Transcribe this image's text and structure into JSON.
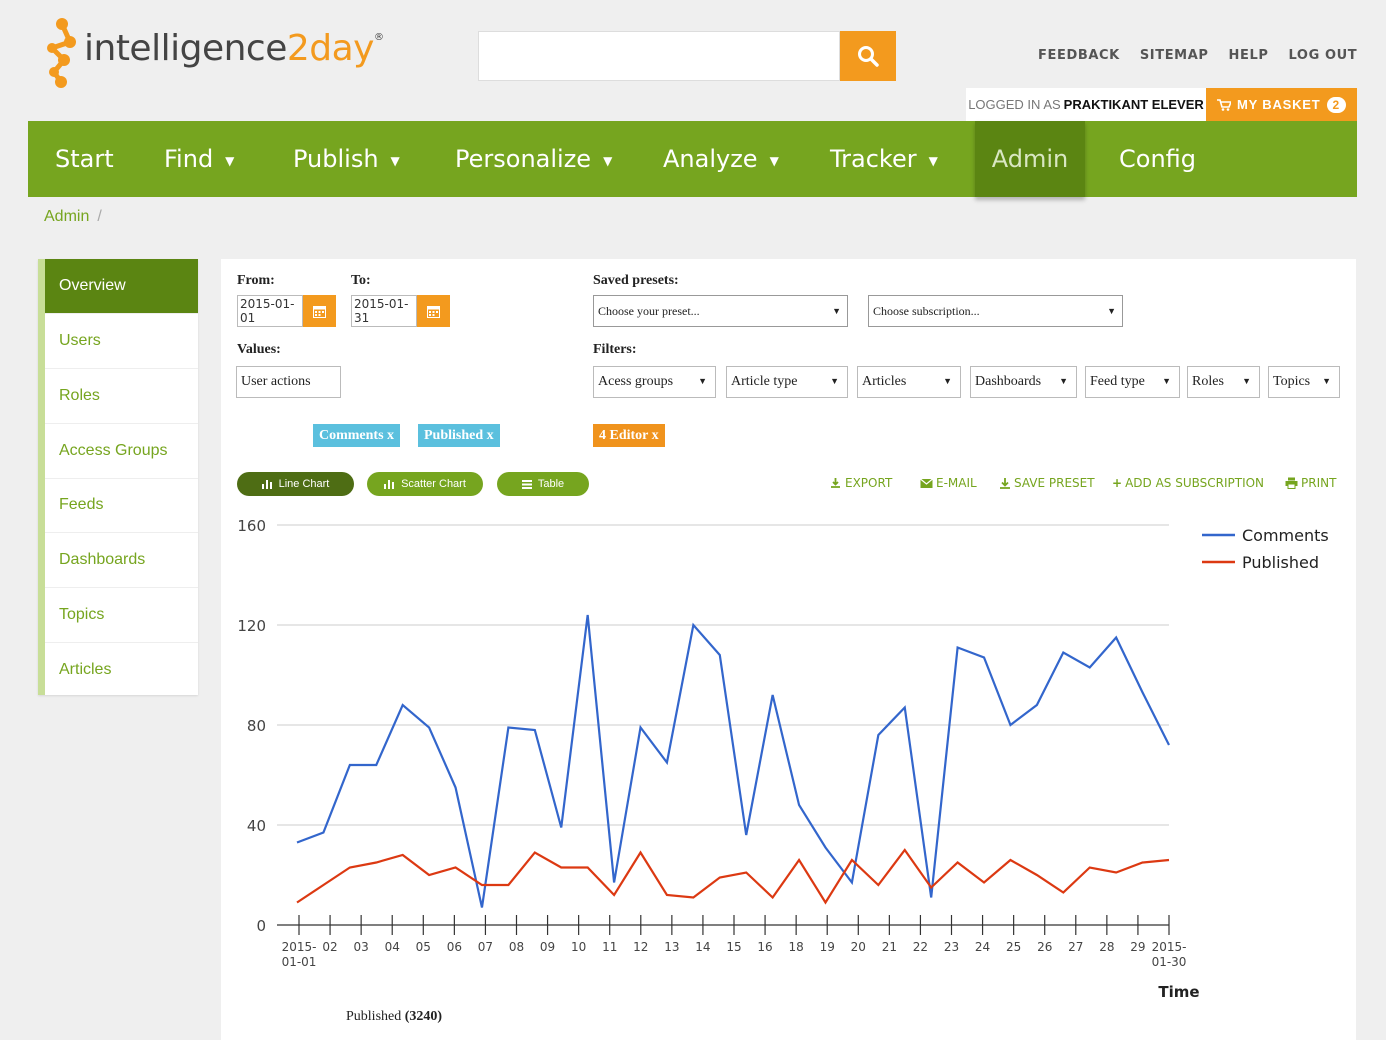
{
  "header": {
    "logo_text_main": "intelligence",
    "logo_text_accent": "2day",
    "logo_reg": "®",
    "search": {
      "placeholder": "",
      "value": ""
    },
    "top_links": [
      "FEEDBACK",
      "SITEMAP",
      "HELP",
      "LOG OUT"
    ],
    "logged_in_prefix": "LOGGED IN AS",
    "logged_in_user": "PRAKTIKANT ELEVER",
    "basket_label": "MY BASKET",
    "basket_count": "2"
  },
  "nav": {
    "items": [
      {
        "label": "Start"
      },
      {
        "label": "Find"
      },
      {
        "label": "Publish"
      },
      {
        "label": "Personalize"
      },
      {
        "label": "Analyze"
      },
      {
        "label": "Tracker"
      },
      {
        "label": "Admin"
      },
      {
        "label": "Config"
      }
    ],
    "active": "Admin"
  },
  "breadcrumb": {
    "current": "Admin",
    "separator": "/"
  },
  "sidebar": {
    "items": [
      {
        "label": "Overview"
      },
      {
        "label": "Users"
      },
      {
        "label": "Roles"
      },
      {
        "label": "Access Groups"
      },
      {
        "label": "Feeds"
      },
      {
        "label": "Dashboards"
      },
      {
        "label": "Topics"
      },
      {
        "label": "Articles"
      }
    ],
    "active": "Overview"
  },
  "form": {
    "from_label": "From:",
    "from_value": "2015-01-01",
    "to_label": "To:",
    "to_value": "2015-01-31",
    "presets_label": "Saved presets:",
    "preset_select": "Choose your preset...",
    "subscription_select": "Choose subscription...",
    "values_label": "Values:",
    "values_value": "User actions",
    "filters_label": "Filters:",
    "filters": [
      "Acess groups",
      "Article type",
      "Articles",
      "Dashboards",
      "Feed type",
      "Roles",
      "Topics"
    ],
    "value_chips": [
      "Comments x",
      "Published x"
    ],
    "filter_chips": [
      "4 Editor x"
    ]
  },
  "view_buttons": [
    "Line Chart",
    "Scatter Chart",
    "Table"
  ],
  "actions": [
    "EXPORT",
    "E-MAIL",
    "SAVE PRESET",
    "ADD AS SUBSCRIPTION",
    "PRINT"
  ],
  "colors": {
    "green": "#76a51f",
    "dark_green": "#5b8512",
    "orange": "#f39a1e",
    "chip_blue": "#5bc0de"
  },
  "chart_data": {
    "type": "line",
    "xlabel": "Time",
    "ylabel": "",
    "ylim": [
      0,
      160
    ],
    "yticks": [
      0,
      40,
      80,
      120,
      160
    ],
    "x_tick_labels": [
      "2015-01-01",
      "02",
      "03",
      "04",
      "05",
      "06",
      "07",
      "08",
      "09",
      "10",
      "11",
      "12",
      "13",
      "14",
      "15",
      "16",
      "18",
      "19",
      "20",
      "21",
      "22",
      "23",
      "24",
      "25",
      "26",
      "27",
      "28",
      "29",
      "2015-01-30"
    ],
    "series": [
      {
        "name": "Comments",
        "color": "#3366cc",
        "values": [
          33,
          37,
          64,
          64,
          88,
          79,
          55,
          7,
          79,
          78,
          39,
          124,
          17,
          79,
          65,
          120,
          108,
          36,
          92,
          48,
          31,
          17,
          76,
          87,
          11,
          111,
          107,
          80,
          88,
          109,
          103,
          115,
          93,
          72
        ]
      },
      {
        "name": "Published",
        "color": "#dc3912",
        "values": [
          9,
          16,
          23,
          25,
          28,
          20,
          23,
          16,
          16,
          29,
          23,
          23,
          12,
          29,
          12,
          11,
          19,
          21,
          11,
          26,
          9,
          26,
          16,
          30,
          15,
          25,
          17,
          26,
          20,
          13,
          23,
          21,
          25,
          26
        ]
      }
    ],
    "legend_position": "top-right",
    "grid": true
  },
  "summary": {
    "label": "Published",
    "value": "3240"
  }
}
